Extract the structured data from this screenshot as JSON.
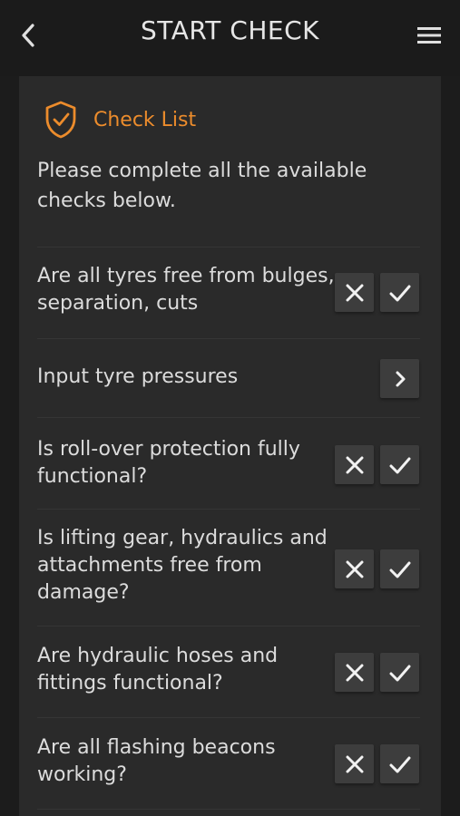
{
  "header": {
    "title": "START CHECK"
  },
  "card": {
    "title": "Check List",
    "intro": "Please complete all the available checks below."
  },
  "rows": [
    {
      "text": "Are all tyres free from bulges, separation, cuts",
      "type": "check"
    },
    {
      "text": "Input tyre pressures",
      "type": "nav"
    },
    {
      "text": "Is roll-over protection fully functional?",
      "type": "check"
    },
    {
      "text": "Is lifting gear, hydraulics and attachments free from damage?",
      "type": "check"
    },
    {
      "text": "Are hydraulic hoses and fittings functional?",
      "type": "check"
    },
    {
      "text": "Are all flashing beacons working?",
      "type": "check"
    }
  ],
  "colors": {
    "accent": "#ec8c2c",
    "background": "#1c1c1c",
    "card": "#2a2a2a",
    "button": "#3d3d3d"
  },
  "icons": {
    "back": "chevron-left-icon",
    "menu": "hamburger-menu-icon",
    "shield": "shield-check-icon",
    "reject": "x-icon",
    "accept": "check-icon",
    "nav": "chevron-right-icon"
  }
}
